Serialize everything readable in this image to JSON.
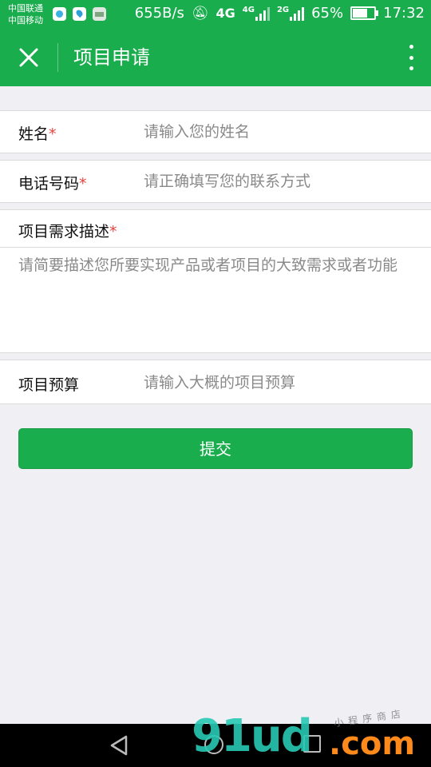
{
  "status_bar": {
    "carrier_1": "中国联通",
    "carrier_2": "中国移动",
    "net_speed": "655B/s",
    "network_1": "4G",
    "network_1_small": "4G",
    "network_2": "2G",
    "battery": "65%",
    "time": "17:32"
  },
  "nav": {
    "title": "项目申请",
    "close_icon": "close-icon",
    "more_icon": "more-vertical-icon"
  },
  "form": {
    "name": {
      "label": "姓名",
      "required_mark": "*",
      "placeholder": "请输入您的姓名"
    },
    "phone": {
      "label": "电话号码",
      "required_mark": "*",
      "placeholder": "请正确填写您的联系方式"
    },
    "description": {
      "label": "项目需求描述",
      "required_mark": "*",
      "placeholder": "请简要描述您所要实现产品或者项目的大致需求或者功能"
    },
    "budget": {
      "label": "项目预算",
      "placeholder": "请输入大概的项目预算"
    },
    "submit_label": "提交"
  },
  "watermark": {
    "logo": "91ud",
    "domain": ".com",
    "subtitle": "小程序商店"
  },
  "colors": {
    "brand": "#1aad4e",
    "required": "#e64340",
    "background": "#efeff4"
  }
}
